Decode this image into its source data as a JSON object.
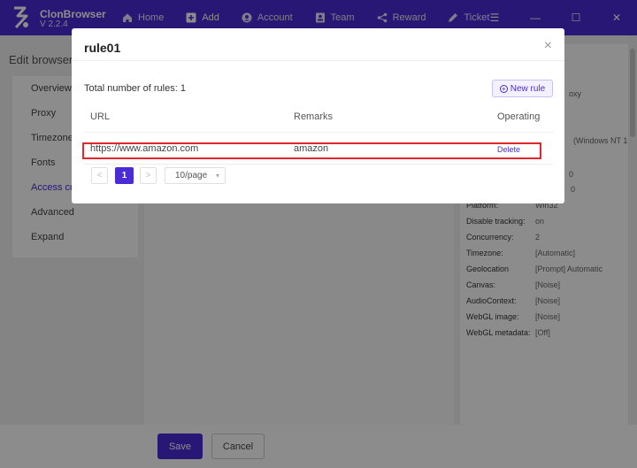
{
  "app": {
    "name": "ClonBrowser",
    "version": "V 2.2.4"
  },
  "nav": [
    {
      "label": "Home",
      "icon": "home-icon"
    },
    {
      "label": "Add",
      "icon": "plus-square-icon"
    },
    {
      "label": "Account",
      "icon": "account-icon"
    },
    {
      "label": "Team",
      "icon": "team-icon"
    },
    {
      "label": "Reward",
      "icon": "share-icon"
    },
    {
      "label": "Ticket",
      "icon": "ticket-icon"
    }
  ],
  "window_controls": {
    "menu": "☰",
    "minimize": "—",
    "maximize": "☐",
    "close": "✕"
  },
  "page": {
    "title": "Edit browser"
  },
  "left_menu": [
    "Overview",
    "Proxy",
    "Timezone&",
    "Fonts",
    "Access co",
    "Advanced",
    "Expand"
  ],
  "right_panel": [
    {
      "key": "",
      "value": "oxy"
    },
    {
      "key": "",
      "value": "(Windows NT 1..."
    },
    {
      "key": "",
      "value": "0"
    },
    {
      "key": "",
      "value": "0"
    },
    {
      "key": "Platform:",
      "value": "Win32"
    },
    {
      "key": "Disable tracking:",
      "value": "on"
    },
    {
      "key": "Concurrency:",
      "value": "2"
    },
    {
      "key": "Timezone:",
      "value": "[Automatic]"
    },
    {
      "key": "Geolocation",
      "value": "[Prompt] Automatic"
    },
    {
      "key": "Canvas:",
      "value": "[Noise]"
    },
    {
      "key": "AudioContext:",
      "value": "[Noise]"
    },
    {
      "key": "WebGL image:",
      "value": "[Noise]"
    },
    {
      "key": "WebGL metadata:",
      "value": "[Off]"
    }
  ],
  "footer": {
    "save": "Save",
    "cancel": "Cancel"
  },
  "modal": {
    "title": "rule01",
    "close": "×",
    "total_label": "Total number of rules: 1",
    "new_rule": "New rule",
    "columns": {
      "url": "URL",
      "remarks": "Remarks",
      "operating": "Operating"
    },
    "rows": [
      {
        "url": "https://www.amazon.com",
        "remarks": "amazon",
        "action": "Delete"
      }
    ],
    "pagination": {
      "prev": "<",
      "current": "1",
      "next": ">",
      "page_size": "10/page"
    }
  },
  "colors": {
    "accent": "#4a2bd6",
    "highlight": "#e3262b"
  }
}
